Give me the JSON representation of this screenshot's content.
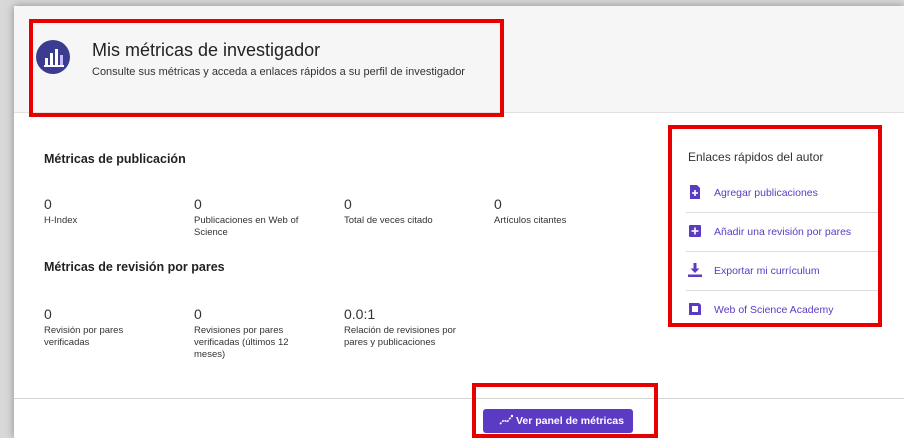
{
  "header": {
    "icon": "metrics-chart-icon",
    "title": "Mis métricas de investigador",
    "subtitle": "Consulte sus métricas y acceda a enlaces rápidos a su perfil de investigador"
  },
  "publication": {
    "title": "Métricas de publicación",
    "metrics": [
      {
        "value": "0",
        "label": "H-Index"
      },
      {
        "value": "0",
        "label": "Publicaciones en Web of Science"
      },
      {
        "value": "0",
        "label": "Total de veces citado"
      },
      {
        "value": "0",
        "label": "Artículos citantes"
      }
    ]
  },
  "peer_review": {
    "title": "Métricas de revisión por pares",
    "metrics": [
      {
        "value": "0",
        "label": "Revisión por pares verificadas"
      },
      {
        "value": "0",
        "label": "Revisiones por pares verificadas (últimos 12 meses)"
      },
      {
        "value": "0.0:1",
        "label": "Relación de revisiones por pares y publicaciones"
      }
    ]
  },
  "quick_links": {
    "title": "Enlaces rápidos del autor",
    "items": [
      {
        "label": "Agregar publicaciones",
        "icon": "add-document-icon"
      },
      {
        "label": "Añadir una revisión por pares",
        "icon": "add-review-icon"
      },
      {
        "label": "Exportar mi currículum",
        "icon": "download-icon"
      },
      {
        "label": "Web of Science Academy",
        "icon": "academy-icon"
      }
    ]
  },
  "button": {
    "label": "Ver panel de métricas",
    "icon": "trend-line-icon"
  },
  "colors": {
    "accent": "#5b3bc4",
    "highlight": "#e60000",
    "header_bg": "#f6f6f7"
  }
}
